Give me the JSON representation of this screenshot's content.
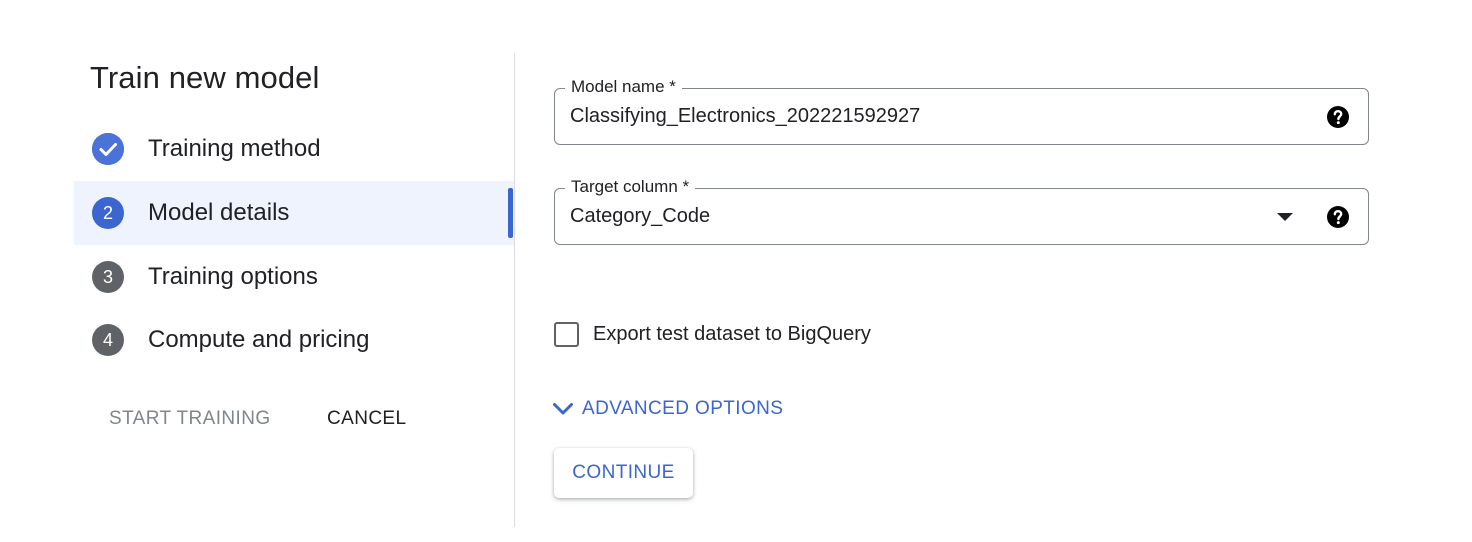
{
  "title": "Train new model",
  "steps": [
    {
      "label": "Training method",
      "state": "done",
      "marker": ""
    },
    {
      "label": "Model details",
      "state": "current",
      "marker": "2"
    },
    {
      "label": "Training options",
      "state": "pending",
      "marker": "3"
    },
    {
      "label": "Compute and pricing",
      "state": "pending",
      "marker": "4"
    }
  ],
  "actions": {
    "start_training": "START TRAINING",
    "cancel": "CANCEL"
  },
  "form": {
    "model_name": {
      "label": "Model name *",
      "value": "Classifying_Electronics_202221592927"
    },
    "target_column": {
      "label": "Target column *",
      "value": "Category_Code"
    },
    "export_checkbox": {
      "label": "Export test dataset to BigQuery",
      "checked": false
    },
    "advanced_options": "ADVANCED OPTIONS",
    "continue": "CONTINUE"
  },
  "colors": {
    "accent": "#3b66cf",
    "active_step_bg": "#eef3fd",
    "pending_circle": "#5f6368"
  },
  "icons": {
    "done_step": "check-circle-icon",
    "help": "help-circle-icon",
    "dropdown": "arrow-drop-down-icon",
    "advanced": "chevron-down-icon"
  }
}
